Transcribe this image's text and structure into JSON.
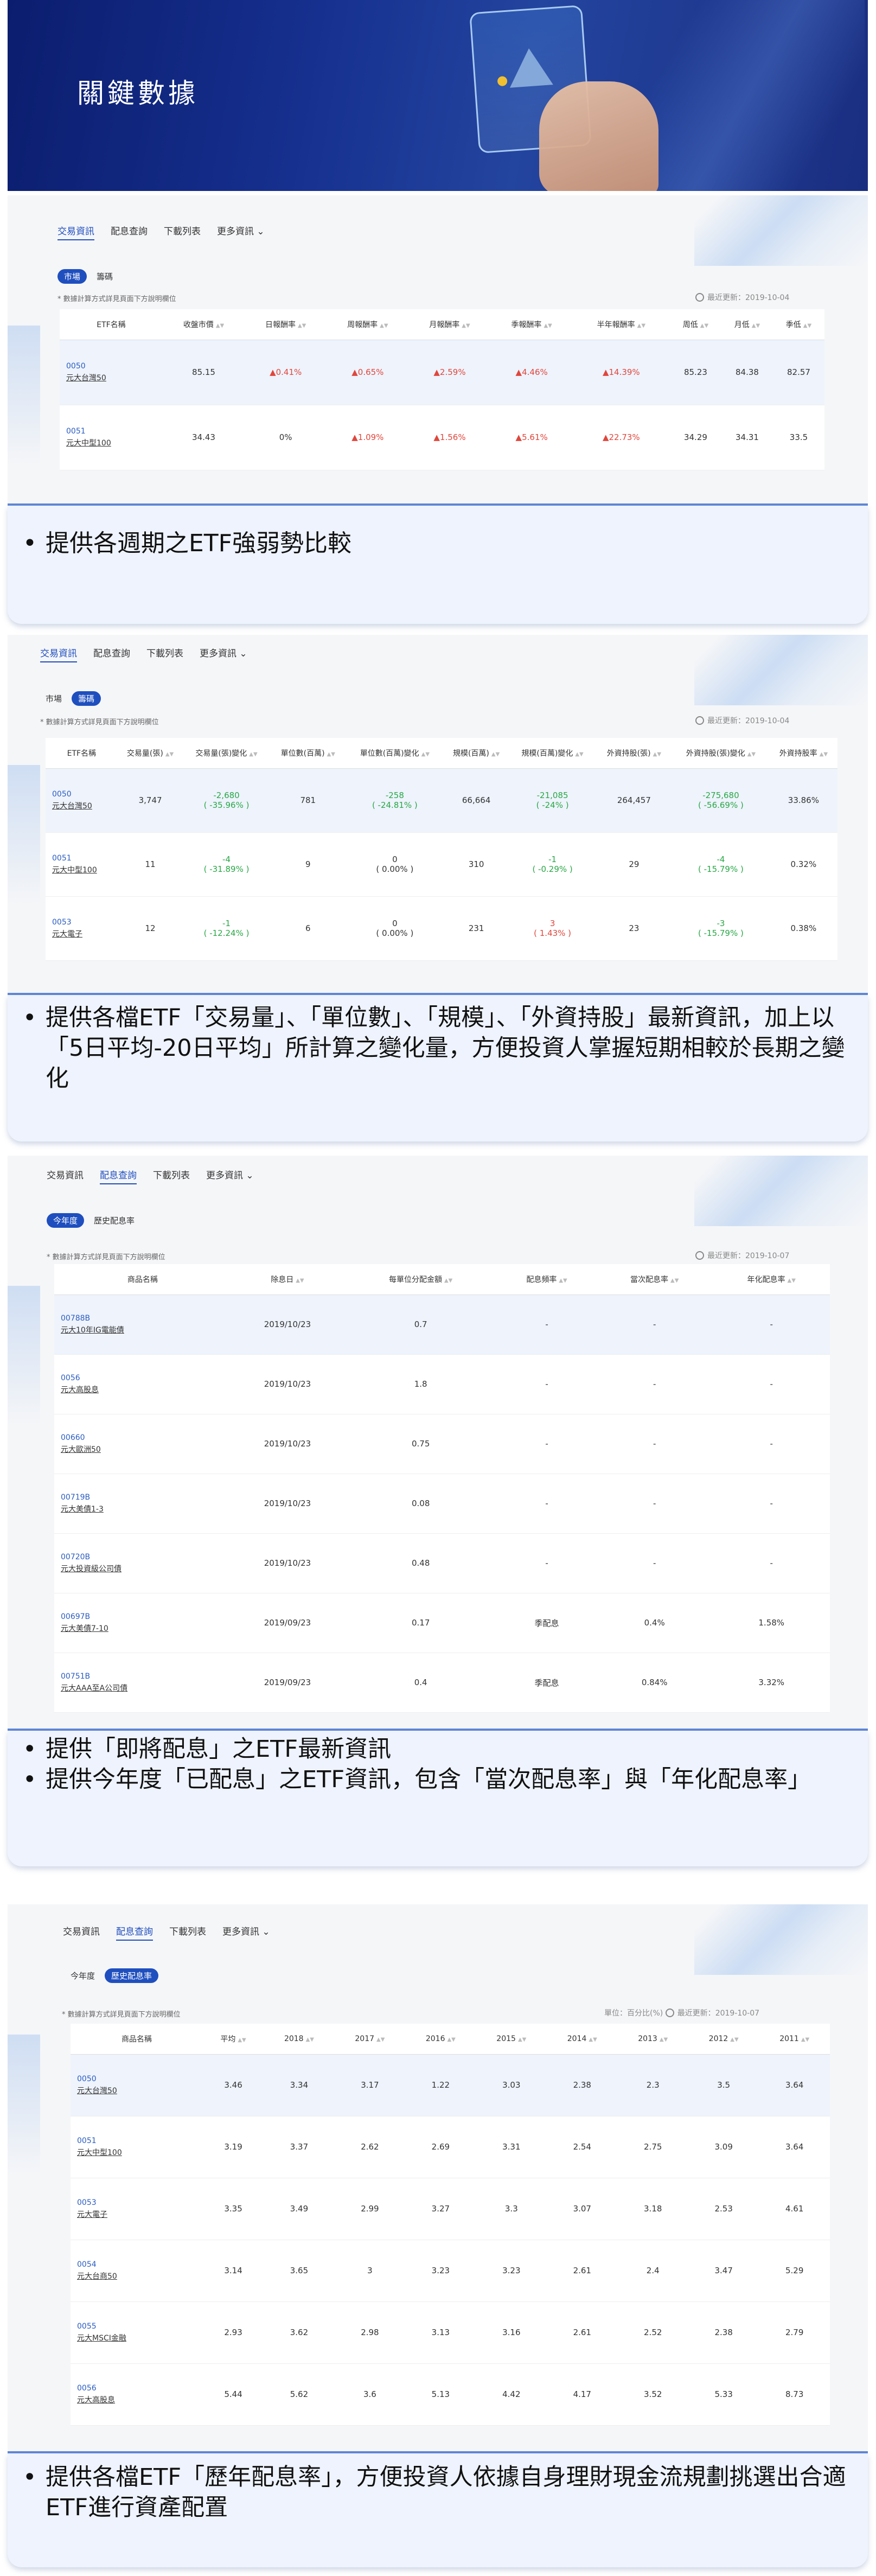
{
  "hero": {
    "title": "關鍵數據"
  },
  "update_prefix": "最近更新：",
  "note": "* 數據計算方式詳見頁面下方說明欄位",
  "s1": {
    "tabs": [
      "交易資訊",
      "配息查詢",
      "下載列表",
      "更多資訊 ⌄"
    ],
    "subtabs": [
      "市場",
      "籌碼"
    ],
    "updated": "2019-10-04",
    "headers": [
      "ETF名稱",
      "收盤市價",
      "日報酬率",
      "周報酬率",
      "月報酬率",
      "季報酬率",
      "半年報酬率",
      "周低",
      "月低",
      "季低"
    ],
    "rows": [
      {
        "code": "0050",
        "name": "元大台灣50",
        "cells": [
          "85.15",
          "▲0.41%",
          "▲0.65%",
          "▲2.59%",
          "▲4.46%",
          "▲14.39%",
          "85.23",
          "84.38",
          "82.57"
        ]
      },
      {
        "code": "0051",
        "name": "元大中型100",
        "cells": [
          "34.43",
          "0%",
          "▲1.09%",
          "▲1.56%",
          "▲5.61%",
          "▲22.73%",
          "34.29",
          "34.31",
          "33.5"
        ]
      }
    ]
  },
  "cap1": [
    "提供各週期之ETF強弱勢比較"
  ],
  "s2": {
    "tabs": [
      "交易資訊",
      "配息查詢",
      "下載列表",
      "更多資訊 ⌄"
    ],
    "subtabs": [
      "市場",
      "籌碼"
    ],
    "updated": "2019-10-04",
    "headers": [
      "ETF名稱",
      "交易量(張)",
      "交易量(張)變化",
      "單位數(百萬)",
      "單位數(百萬)變化",
      "規模(百萬)",
      "規模(百萬)變化",
      "外資持股(張)",
      "外資持股(張)變化",
      "外資持股率"
    ],
    "rows": [
      {
        "code": "0050",
        "name": "元大台灣50",
        "cells": [
          "3,747",
          "-2,680\n( -35.96% )",
          "781",
          "-258\n( -24.81% )",
          "66,664",
          "-21,085\n( -24% )",
          "264,457",
          "-275,680\n( -56.69% )",
          "33.86%"
        ]
      },
      {
        "code": "0051",
        "name": "元大中型100",
        "cells": [
          "11",
          "-4\n( -31.89% )",
          "9",
          "0\n( 0.00% )",
          "310",
          "-1\n( -0.29% )",
          "29",
          "-4\n( -15.79% )",
          "0.32%"
        ]
      },
      {
        "code": "0053",
        "name": "元大電子",
        "cells": [
          "12",
          "-1\n( -12.24% )",
          "6",
          "0\n( 0.00% )",
          "231",
          "3\n( 1.43% )",
          "23",
          "-3\n( -15.79% )",
          "0.38%"
        ]
      }
    ]
  },
  "cap2": [
    "提供各檔ETF「交易量」、「單位數」、「規模」、「外資持股」最新資訊，加上以「5日平均-20日平均」所計算之變化量，方便投資人掌握短期相較於長期之變化"
  ],
  "s3": {
    "tabs": [
      "交易資訊",
      "配息查詢",
      "下載列表",
      "更多資訊 ⌄"
    ],
    "subtabs": [
      "今年度",
      "歷史配息率"
    ],
    "updated": "2019-10-07",
    "headers": [
      "商品名稱",
      "除息日",
      "每單位分配金額",
      "配息頻率",
      "當次配息率",
      "年化配息率"
    ],
    "rows": [
      {
        "code": "00788B",
        "name": "元大10年IG電能債",
        "cells": [
          "2019/10/23",
          "0.7",
          "-",
          "-",
          "-"
        ]
      },
      {
        "code": "0056",
        "name": "元大高股息",
        "cells": [
          "2019/10/23",
          "1.8",
          "-",
          "-",
          "-"
        ]
      },
      {
        "code": "00660",
        "name": "元大歐洲50",
        "cells": [
          "2019/10/23",
          "0.75",
          "-",
          "-",
          "-"
        ]
      },
      {
        "code": "00719B",
        "name": "元大美債1-3",
        "cells": [
          "2019/10/23",
          "0.08",
          "-",
          "-",
          "-"
        ]
      },
      {
        "code": "00720B",
        "name": "元大投資級公司債",
        "cells": [
          "2019/10/23",
          "0.48",
          "-",
          "-",
          "-"
        ]
      },
      {
        "code": "00697B",
        "name": "元大美債7-10",
        "cells": [
          "2019/09/23",
          "0.17",
          "季配息",
          "0.4%",
          "1.58%"
        ]
      },
      {
        "code": "00751B",
        "name": "元大AAA至A公司債",
        "cells": [
          "2019/09/23",
          "0.4",
          "季配息",
          "0.84%",
          "3.32%"
        ]
      }
    ]
  },
  "cap3": [
    "提供「即將配息」之ETF最新資訊",
    "提供今年度「已配息」之ETF資訊，包含「當次配息率」與「年化配息率」"
  ],
  "s4": {
    "tabs": [
      "交易資訊",
      "配息查詢",
      "下載列表",
      "更多資訊 ⌄"
    ],
    "subtabs": [
      "今年度",
      "歷史配息率"
    ],
    "unit": "單位：百分比(%)",
    "updated": "2019-10-07",
    "headers": [
      "商品名稱",
      "平均",
      "2018",
      "2017",
      "2016",
      "2015",
      "2014",
      "2013",
      "2012",
      "2011"
    ],
    "rows": [
      {
        "code": "0050",
        "name": "元大台灣50",
        "cells": [
          "3.46",
          "3.34",
          "3.17",
          "1.22",
          "3.03",
          "2.38",
          "2.3",
          "3.5",
          "3.64"
        ]
      },
      {
        "code": "0051",
        "name": "元大中型100",
        "cells": [
          "3.19",
          "3.37",
          "2.62",
          "2.69",
          "3.31",
          "2.54",
          "2.75",
          "3.09",
          "3.64"
        ]
      },
      {
        "code": "0053",
        "name": "元大電子",
        "cells": [
          "3.35",
          "3.49",
          "2.99",
          "3.27",
          "3.3",
          "3.07",
          "3.18",
          "2.53",
          "4.61"
        ]
      },
      {
        "code": "0054",
        "name": "元大台商50",
        "cells": [
          "3.14",
          "3.65",
          "3",
          "3.23",
          "3.23",
          "2.61",
          "2.4",
          "3.47",
          "5.29"
        ]
      },
      {
        "code": "0055",
        "name": "元大MSCI金融",
        "cells": [
          "2.93",
          "3.62",
          "2.98",
          "3.13",
          "3.16",
          "2.61",
          "2.52",
          "2.38",
          "2.79"
        ]
      },
      {
        "code": "0056",
        "name": "元大高股息",
        "cells": [
          "5.44",
          "5.62",
          "3.6",
          "5.13",
          "4.42",
          "4.17",
          "3.52",
          "5.33",
          "8.73"
        ]
      }
    ]
  },
  "cap4": [
    "提供各檔ETF「歷年配息率」，方便投資人依據自身理財現金流規劃挑選出合適ETF進行資產配置"
  ]
}
